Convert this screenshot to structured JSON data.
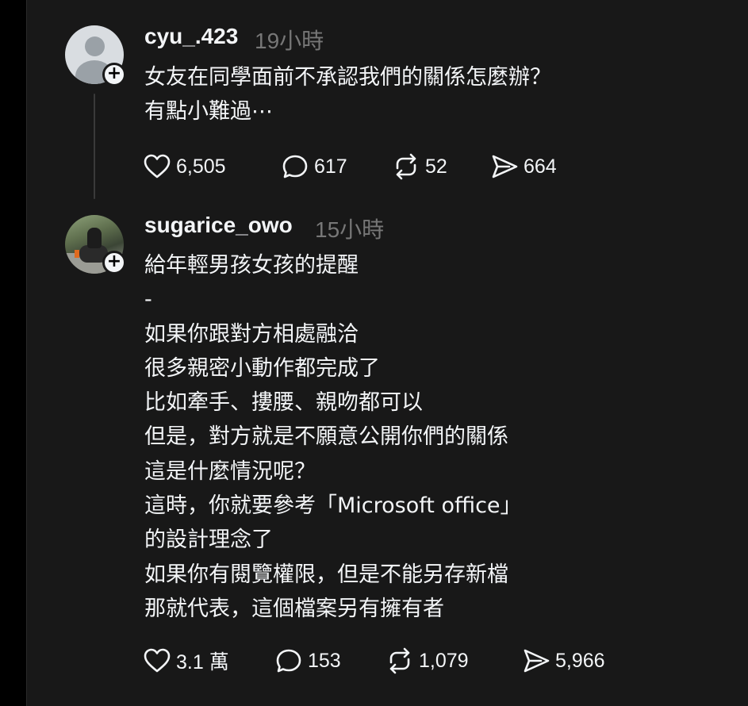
{
  "posts": [
    {
      "username": "cyu_.423",
      "time": "19小時",
      "lines": [
        "女友在同學面前不承認我們的關係怎麼辦？",
        "有點小難過⋯"
      ],
      "likes": "6,505",
      "comments": "617",
      "reposts": "52",
      "shares": "664"
    },
    {
      "username": "sugarice_owo",
      "time": "15小時",
      "lines": [
        "給年輕男孩女孩的提醒",
        "-",
        "如果你跟對方相處融洽",
        "很多親密小動作都完成了",
        "比如牽手、摟腰、親吻都可以",
        "但是，對方就是不願意公開你們的關係",
        "這是什麼情況呢？",
        "這時，你就要參考「Microsoft office」",
        "的設計理念了",
        "如果你有閱覽權限，但是不能另存新檔",
        "那就代表，這個檔案另有擁有者"
      ],
      "likes": "3.1 萬",
      "comments": "153",
      "reposts": "1,079",
      "shares": "5,966"
    }
  ],
  "icons": {
    "like": "heart-icon",
    "comment": "comment-bubble-icon",
    "repost": "repost-arrows-icon",
    "share": "send-icon",
    "follow": "plus-icon"
  },
  "colors": {
    "background": "#181818",
    "text": "#f3f5f7",
    "muted": "#777777"
  }
}
